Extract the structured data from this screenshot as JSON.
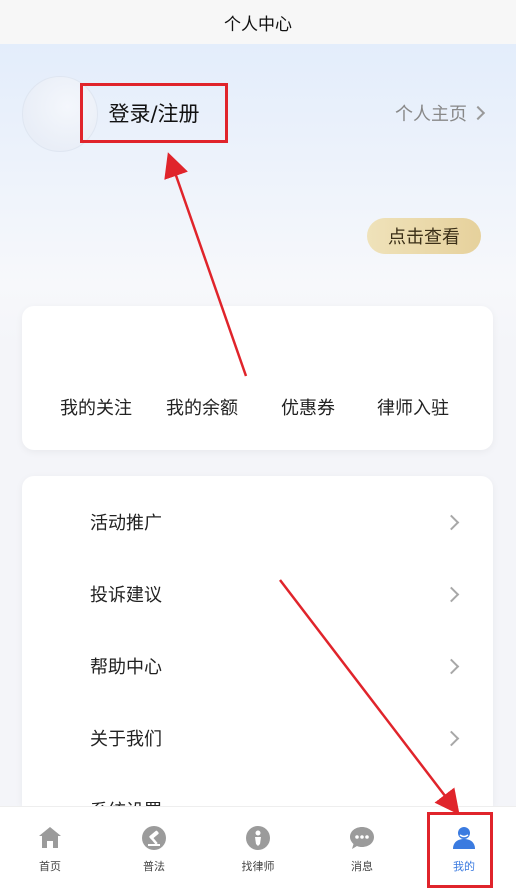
{
  "header": {
    "title": "个人中心"
  },
  "profile": {
    "login_label": "登录/注册",
    "home_label": "个人主页",
    "view_button": "点击查看"
  },
  "quick_actions": [
    {
      "label": "我的关注"
    },
    {
      "label": "我的余额"
    },
    {
      "label": "优惠券"
    },
    {
      "label": "律师入驻"
    }
  ],
  "menu": [
    {
      "label": "活动推广"
    },
    {
      "label": "投诉建议"
    },
    {
      "label": "帮助中心"
    },
    {
      "label": "关于我们"
    },
    {
      "label": "系统设置"
    }
  ],
  "tabbar": {
    "items": [
      {
        "label": "首页",
        "icon": "home-icon"
      },
      {
        "label": "普法",
        "icon": "gavel-icon"
      },
      {
        "label": "找律师",
        "icon": "lawyer-icon"
      },
      {
        "label": "消息",
        "icon": "message-icon"
      },
      {
        "label": "我的",
        "icon": "user-icon",
        "active": true
      }
    ]
  },
  "colors": {
    "annotation_red": "#e0242b",
    "accent_blue": "#3b7be0",
    "gold_button": "#e6d19c"
  }
}
